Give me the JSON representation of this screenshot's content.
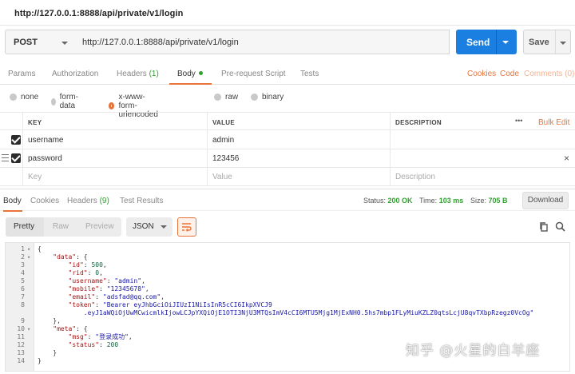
{
  "window": {
    "title": "http://127.0.0.1:8888/api/private/v1/login"
  },
  "request": {
    "method": "POST",
    "url": "http://127.0.0.1:8888/api/private/v1/login",
    "send_label": "Send",
    "save_label": "Save"
  },
  "request_tabs": {
    "params": "Params",
    "authorization": "Authorization",
    "headers": "Headers",
    "headers_count": "(1)",
    "body": "Body",
    "prerequest": "Pre-request Script",
    "tests": "Tests",
    "active": "Body"
  },
  "request_links": {
    "cookies": "Cookies",
    "code": "Code",
    "comments": "Comments (0)"
  },
  "body_types": {
    "options": [
      "none",
      "form-data",
      "x-www-form-urlencoded",
      "raw",
      "binary"
    ],
    "selected": "x-www-form-urlencoded"
  },
  "kv_table": {
    "headers": {
      "key": "KEY",
      "value": "VALUE",
      "description": "DESCRIPTION",
      "more": "•••",
      "bulk_edit": "Bulk Edit"
    },
    "rows": [
      {
        "key": "username",
        "value": "admin",
        "description": "",
        "checked": true
      },
      {
        "key": "password",
        "value": "123456",
        "description": "",
        "checked": true
      }
    ],
    "placeholders": {
      "key": "Key",
      "value": "Value",
      "description": "Description"
    }
  },
  "response_tabs": {
    "body": "Body",
    "cookies": "Cookies",
    "headers": "Headers",
    "headers_count": "(9)",
    "test_results": "Test Results"
  },
  "response_status": {
    "status_label": "Status:",
    "status_value": "200 OK",
    "time_label": "Time:",
    "time_value": "103 ms",
    "size_label": "Size:",
    "size_value": "705 B",
    "download": "Download"
  },
  "view_modes": {
    "pretty": "Pretty",
    "raw": "Raw",
    "preview": "Preview",
    "format": "JSON",
    "selected": "Pretty"
  },
  "code_lines": [
    {
      "n": "1",
      "fold": true,
      "text": "{"
    },
    {
      "n": "2",
      "fold": true,
      "text": "    \"data\": {"
    },
    {
      "n": "3",
      "fold": false,
      "text": "        \"id\": 500,"
    },
    {
      "n": "4",
      "fold": false,
      "text": "        \"rid\": 0,"
    },
    {
      "n": "5",
      "fold": false,
      "text": "        \"username\": \"admin\","
    },
    {
      "n": "6",
      "fold": false,
      "text": "        \"mobile\": \"12345678\","
    },
    {
      "n": "7",
      "fold": false,
      "text": "        \"email\": \"adsfad@qq.com\","
    },
    {
      "n": "8",
      "fold": false,
      "text": "        \"token\": \"Bearer eyJhbGciOiJIUzI1NiIsInR5cCI6IkpXVCJ9"
    },
    {
      "n": "",
      "fold": false,
      "text": "            .eyJ1aWQiOjUwMCwicmlkIjowLCJpYXQiOjE1OTI3NjU3MTQsImV4cCI6MTU5Mjg1MjExNH0.5hs7mbp1FLyMiuKZLZ0qtsLcjU8qvTXbpRzegz0VcOg\""
    },
    {
      "n": "9",
      "fold": false,
      "text": "    },"
    },
    {
      "n": "10",
      "fold": true,
      "text": "    \"meta\": {"
    },
    {
      "n": "11",
      "fold": false,
      "text": "        \"msg\": \"登录成功\","
    },
    {
      "n": "12",
      "fold": false,
      "text": "        \"status\": 200"
    },
    {
      "n": "13",
      "fold": false,
      "text": "    }"
    },
    {
      "n": "14",
      "fold": false,
      "text": "}"
    }
  ],
  "icons": {
    "wrap": "wrap-lines-icon",
    "copy": "copy-icon",
    "search": "search-icon",
    "delete": "close-icon",
    "drag": "drag-handle-icon"
  },
  "colors": {
    "accent": "#e8743b",
    "send": "#1a7fe0",
    "success": "#30a030"
  },
  "watermark": "知乎 @火星的白羊座"
}
